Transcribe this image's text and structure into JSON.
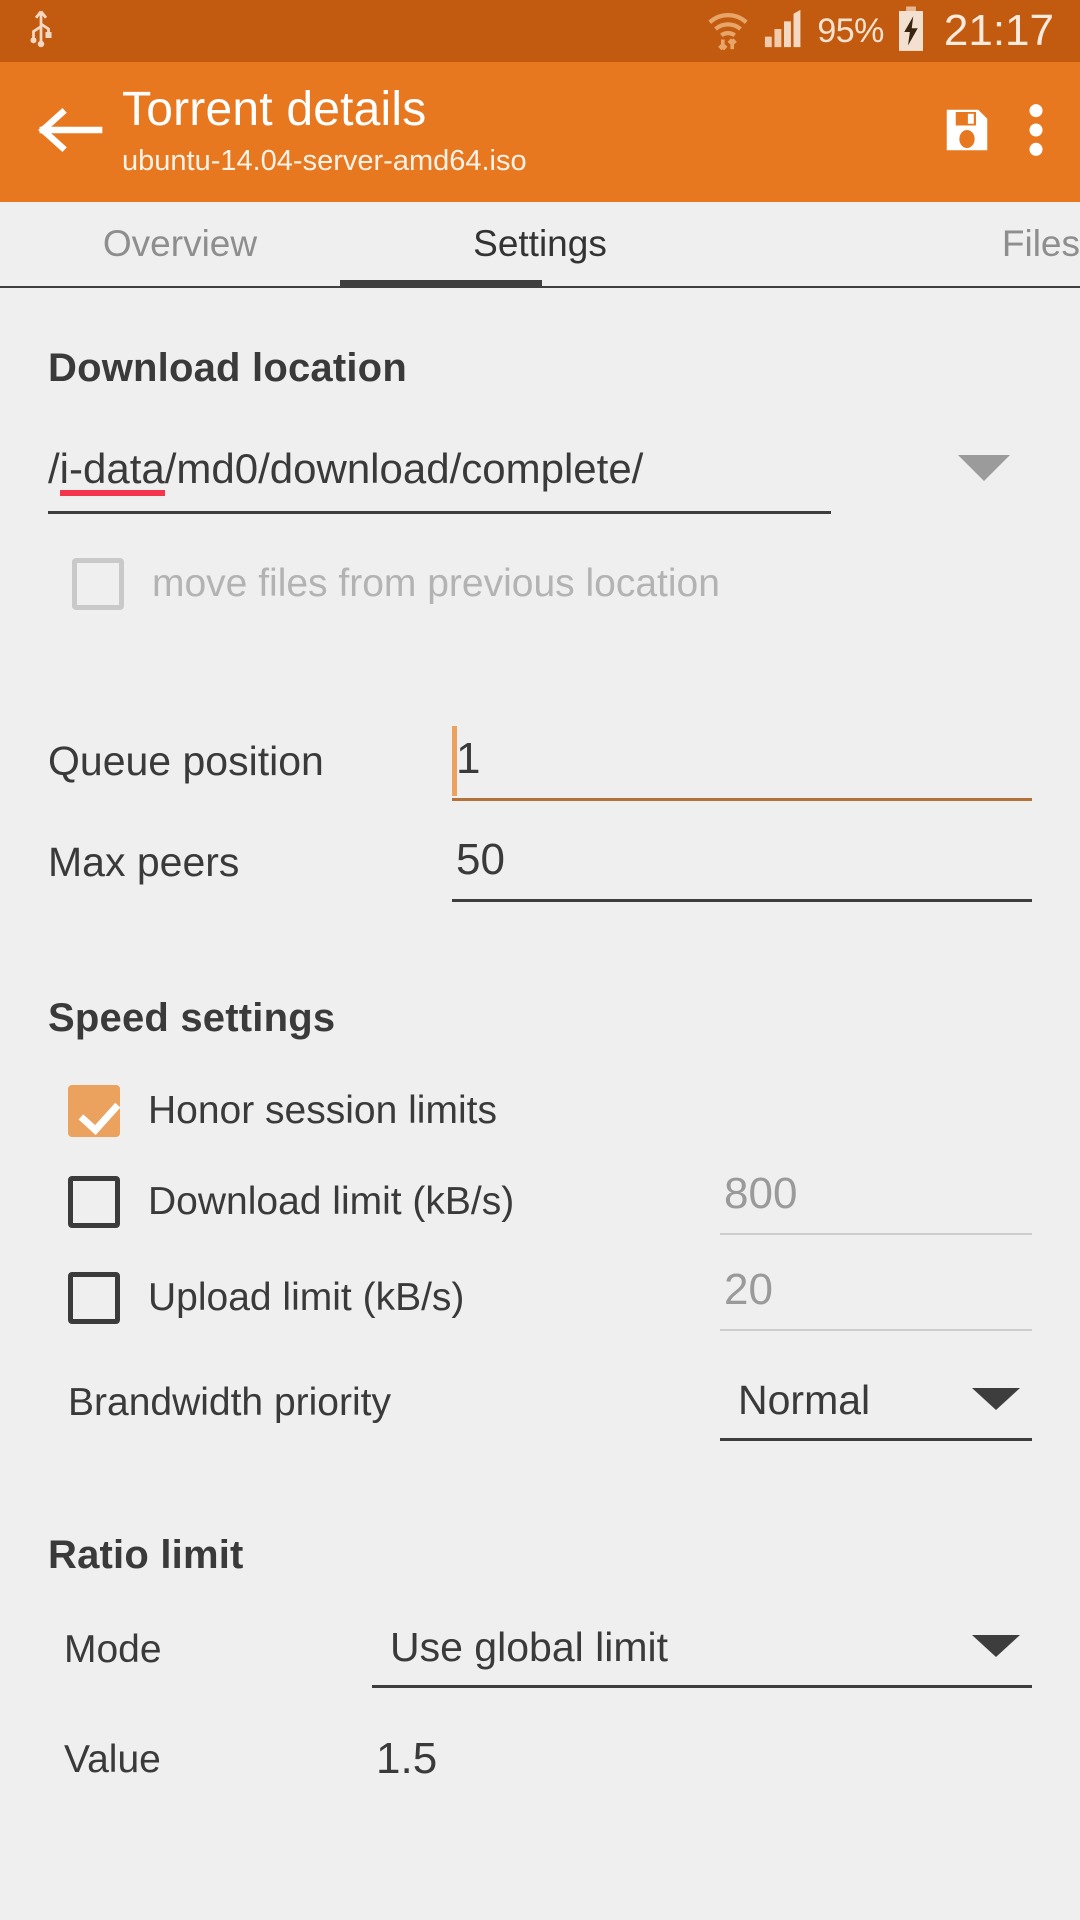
{
  "statusbar": {
    "usb_icon": "usb-icon",
    "wifi_icon": "wifi-transfer-icon",
    "signal_icon": "cellular-signal-icon",
    "battery_percent": "95%",
    "battery_icon": "battery-charging-icon",
    "time": "21:17"
  },
  "appbar": {
    "back_icon": "back-arrow-icon",
    "title": "Torrent details",
    "subtitle": "ubuntu-14.04-server-amd64.iso",
    "save_icon": "save-icon",
    "overflow_icon": "overflow-menu-icon",
    "background": "#e8781f"
  },
  "tabs": [
    {
      "label": "Overview",
      "active": false
    },
    {
      "label": "Settings",
      "active": true
    },
    {
      "label": "Files",
      "active": false
    }
  ],
  "download_location": {
    "heading": "Download location",
    "path_prefix": "/",
    "path_misspelled": "i-data",
    "path_suffix": "/md0/download/complete/",
    "full_path": "/i-data/md0/download/complete/",
    "dropdown_icon": "chevron-down-icon",
    "move_files": {
      "label": "move files from previous location",
      "checked": false,
      "disabled": true
    }
  },
  "queue": {
    "queue_position_label": "Queue position",
    "queue_position_value": "1",
    "max_peers_label": "Max peers",
    "max_peers_value": "50"
  },
  "speed_settings": {
    "heading": "Speed settings",
    "honor_session_limits": {
      "label": "Honor session limits",
      "checked": true
    },
    "download_limit": {
      "label": "Download limit (kB/s)",
      "value": "800",
      "checked": false
    },
    "upload_limit": {
      "label": "Upload limit (kB/s)",
      "value": "20",
      "checked": false
    },
    "bandwidth_priority": {
      "label": "Brandwidth priority",
      "value": "Normal",
      "dropdown_icon": "chevron-down-icon"
    }
  },
  "ratio_limit": {
    "heading": "Ratio limit",
    "mode_label": "Mode",
    "mode_value": "Use global limit",
    "mode_dropdown_icon": "chevron-down-icon",
    "value_label": "Value",
    "value_value": "1.5"
  },
  "colors": {
    "accent": "#e8781f",
    "status_bar": "#c25b0f",
    "checkbox_checked": "#eaa25e",
    "spellcheck_underline": "#f4364c",
    "background": "#efefef"
  }
}
